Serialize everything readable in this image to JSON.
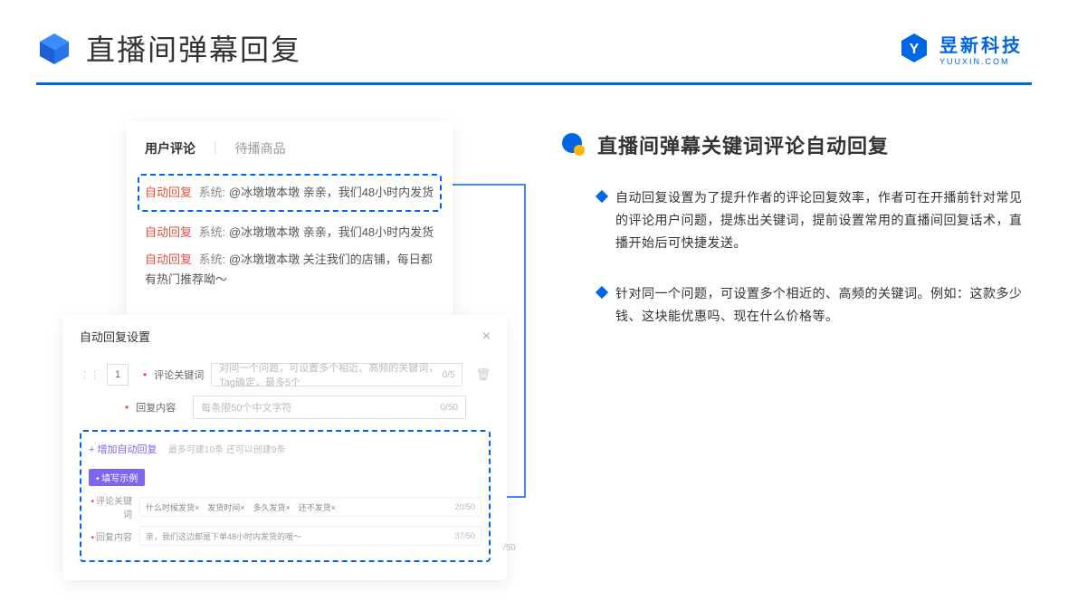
{
  "header": {
    "title": "直播间弹幕回复",
    "brand_name": "昱新科技",
    "brand_sub": "YUUXIN.COM"
  },
  "comments_card": {
    "tab1": "用户评论",
    "tab2": "待播商品",
    "row1_badge": "自动回复",
    "row1_sys": "系统:",
    "row1_text": "@冰墩墩本墩 亲亲，我们48小时内发货",
    "row2_badge": "自动回复",
    "row2_sys": "系统:",
    "row2_text": "@冰墩墩本墩 亲亲，我们48小时内发货",
    "row3_badge": "自动回复",
    "row3_sys": "系统:",
    "row3_text": "@冰墩墩本墩 关注我们的店铺，每日都有热门推荐呦～"
  },
  "settings_card": {
    "title": "自动回复设置",
    "num": "1",
    "label_keyword": "评论关键词",
    "placeholder_keyword": "对同一个问题，可设置多个相近、高频的关键词，Tag确定，最多5个",
    "counter_keyword": "0/5",
    "label_content": "回复内容",
    "placeholder_content": "每条限50个中文字符",
    "counter_content": "0/50",
    "add_link": "+ 增加自动回复",
    "add_hint": "最多可建10条 还可以创建9条",
    "example_tag": "• 填写示例",
    "ex_label_kw": "评论关键词",
    "ex_kw_tags": "什么时候发货×　发货时间×　多久发货×　还不发货×",
    "ex_kw_counter": "20/50",
    "ex_label_content": "回复内容",
    "ex_content_text": "亲，我们这边都是下单48小时内发货的哦～",
    "ex_content_counter": "37/50",
    "outer_counter": "/50"
  },
  "right": {
    "section_title": "直播间弹幕关键词评论自动回复",
    "bullet1": "自动回复设置为了提升作者的评论回复效率，作者可在开播前针对常见的评论用户问题，提炼出关键词，提前设置常用的直播间回复话术，直播开始后可快捷发送。",
    "bullet2": "针对同一个问题，可设置多个相近的、高频的关键词。例如：这款多少钱、这块能优惠吗、现在什么价格等。"
  }
}
